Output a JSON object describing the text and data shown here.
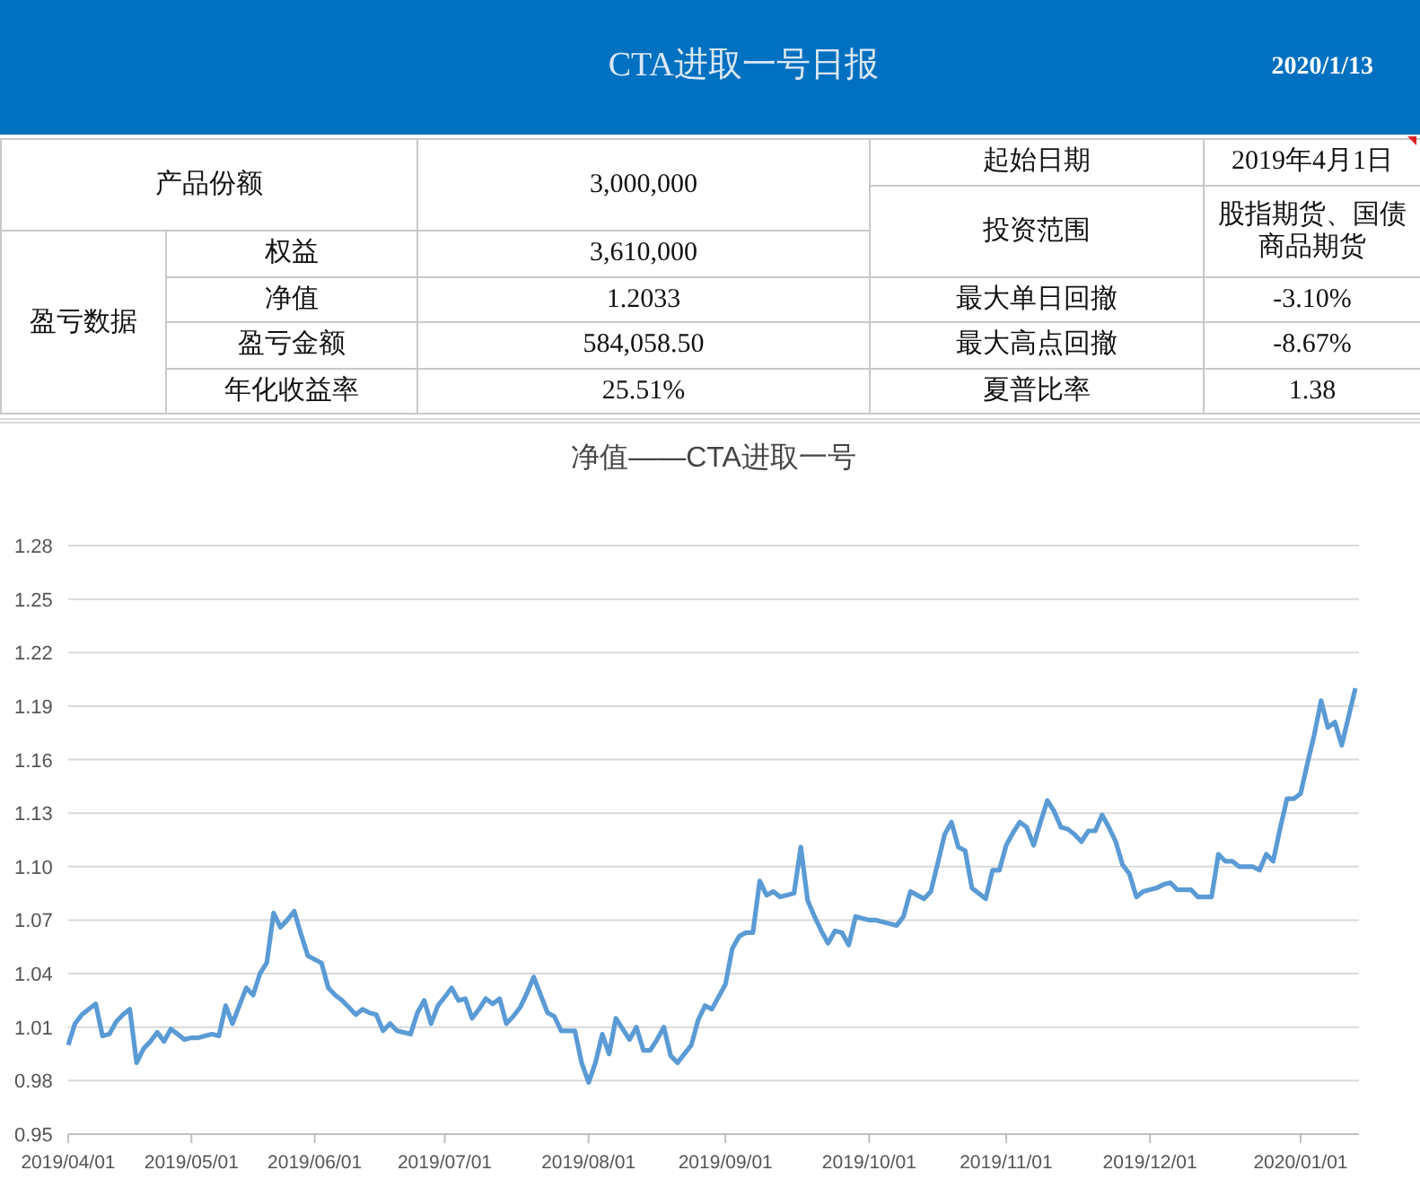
{
  "header": {
    "title": "CTA进取一号日报",
    "date": "2020/1/13"
  },
  "summary": {
    "share": {
      "label": "产品份额",
      "value": "3,000,000"
    },
    "start_date": {
      "label": "起始日期",
      "value": "2019年4月1日"
    },
    "scope": {
      "label": "投资范围",
      "lines": [
        "股指期货、国债",
        "商品期货"
      ]
    },
    "pnl": {
      "label": "盈亏数据",
      "rows": [
        {
          "label": "权益",
          "value": "3,610,000"
        },
        {
          "label": "净值",
          "value": "1.2033"
        },
        {
          "label": "盈亏金额",
          "value": "584,058.50"
        },
        {
          "label": "年化收益率",
          "value": "25.51%"
        }
      ]
    },
    "risk": [
      {
        "label": "最大单日回撤",
        "value": "-3.10%"
      },
      {
        "label": "最大高点回撤",
        "value": "-8.67%"
      },
      {
        "label": "夏普比率",
        "value": "1.38"
      }
    ]
  },
  "chart": {
    "chart_data": {
      "type": "line",
      "title": "净值——CTA进取一号",
      "categories": [
        "2019/04/01",
        null,
        null,
        null,
        null,
        null,
        null,
        null,
        null,
        null,
        null,
        null,
        null,
        null,
        null,
        null,
        null,
        null,
        "2019/05/01",
        null,
        null,
        null,
        null,
        null,
        null,
        null,
        null,
        null,
        null,
        null,
        null,
        null,
        null,
        null,
        null,
        null,
        "2019/06/01",
        null,
        null,
        null,
        null,
        null,
        null,
        null,
        null,
        null,
        null,
        null,
        null,
        null,
        null,
        null,
        null,
        null,
        null,
        "2019/07/01",
        null,
        null,
        null,
        null,
        null,
        null,
        null,
        null,
        null,
        null,
        null,
        null,
        null,
        null,
        null,
        null,
        null,
        null,
        null,
        null,
        "2019/08/01",
        null,
        null,
        null,
        null,
        null,
        null,
        null,
        null,
        null,
        null,
        null,
        null,
        null,
        null,
        null,
        null,
        null,
        null,
        null,
        "2019/09/01",
        null,
        null,
        null,
        null,
        null,
        null,
        null,
        null,
        null,
        null,
        null,
        null,
        null,
        null,
        null,
        null,
        null,
        null,
        null,
        null,
        "2019/10/01",
        null,
        null,
        null,
        null,
        null,
        null,
        null,
        null,
        null,
        null,
        null,
        null,
        null,
        null,
        null,
        null,
        null,
        null,
        null,
        "2019/11/01",
        null,
        null,
        null,
        null,
        null,
        null,
        null,
        null,
        null,
        null,
        null,
        null,
        null,
        null,
        null,
        null,
        null,
        null,
        null,
        null,
        "2019/12/01",
        null,
        null,
        null,
        null,
        null,
        null,
        null,
        null,
        null,
        null,
        null,
        null,
        null,
        null,
        null,
        null,
        null,
        null,
        null,
        null,
        null,
        "2020/01/01",
        null,
        null,
        null,
        null,
        null,
        null,
        null,
        null
      ],
      "series": [
        {
          "color": "#5b9bd5",
          "values": [
            1.0,
            1.012,
            1.017,
            1.02,
            1.023,
            1.005,
            1.006,
            1.013,
            1.017,
            1.02,
            0.99,
            0.998,
            1.002,
            1.007,
            1.002,
            1.009,
            1.006,
            1.003,
            1.004,
            1.004,
            1.005,
            1.006,
            1.005,
            1.022,
            1.012,
            1.022,
            1.032,
            1.028,
            1.04,
            1.046,
            1.074,
            1.066,
            1.07,
            1.075,
            1.062,
            1.05,
            1.048,
            1.046,
            1.032,
            1.028,
            1.025,
            1.021,
            1.017,
            1.02,
            1.018,
            1.017,
            1.008,
            1.012,
            1.008,
            1.007,
            1.006,
            1.018,
            1.025,
            1.012,
            1.022,
            1.027,
            1.032,
            1.025,
            1.026,
            1.015,
            1.02,
            1.026,
            1.023,
            1.026,
            1.012,
            1.016,
            1.021,
            1.029,
            1.038,
            1.028,
            1.018,
            1.016,
            1.008,
            1.008,
            1.008,
            0.99,
            0.979,
            0.99,
            1.006,
            0.995,
            1.015,
            1.009,
            1.003,
            1.01,
            0.997,
            0.997,
            1.003,
            1.01,
            0.994,
            0.99,
            0.995,
            1.0,
            1.014,
            1.022,
            1.02,
            1.027,
            1.034,
            1.054,
            1.061,
            1.063,
            1.063,
            1.092,
            1.084,
            1.086,
            1.083,
            1.084,
            1.085,
            1.111,
            1.081,
            1.072,
            1.064,
            1.057,
            1.064,
            1.063,
            1.056,
            1.072,
            1.071,
            1.07,
            1.07,
            1.069,
            1.068,
            1.067,
            1.072,
            1.086,
            1.084,
            1.082,
            1.086,
            1.102,
            1.118,
            1.125,
            1.111,
            1.109,
            1.088,
            1.085,
            1.082,
            1.098,
            1.098,
            1.112,
            1.119,
            1.125,
            1.122,
            1.112,
            1.125,
            1.137,
            1.131,
            1.122,
            1.121,
            1.118,
            1.114,
            1.12,
            1.12,
            1.129,
            1.122,
            1.114,
            1.101,
            1.096,
            1.083,
            1.086,
            1.087,
            1.088,
            1.09,
            1.091,
            1.087,
            1.087,
            1.087,
            1.083,
            1.083,
            1.083,
            1.107,
            1.103,
            1.103,
            1.1,
            1.1,
            1.1,
            1.098,
            1.107,
            1.103,
            1.121,
            1.138,
            1.138,
            1.141,
            1.158,
            1.174,
            1.193,
            1.178,
            1.181,
            1.168,
            1.184,
            1.2
          ]
        }
      ],
      "grid": true,
      "ylim": [
        0.95,
        1.28
      ],
      "yticks": [
        0.95,
        0.98,
        1.01,
        1.04,
        1.07,
        {
          "value": 1.1,
          "label": "1.10"
        },
        1.13,
        1.16,
        1.19,
        1.22,
        1.25,
        1.28
      ]
    }
  }
}
